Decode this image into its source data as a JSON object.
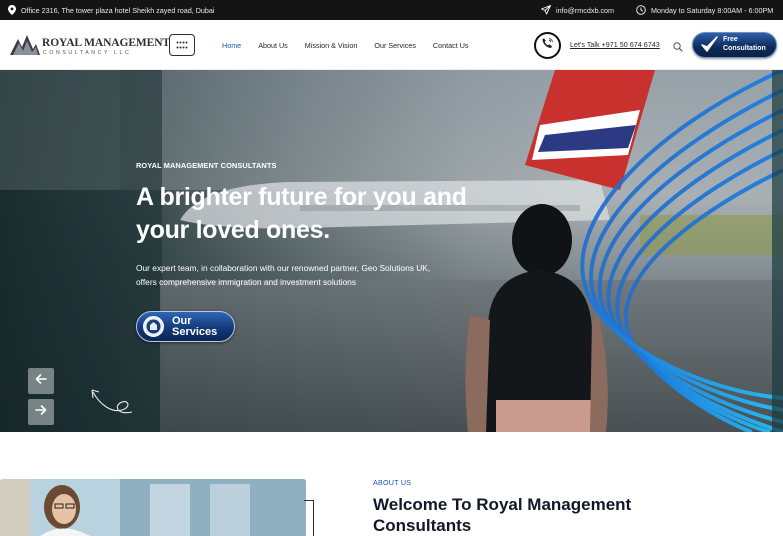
{
  "topbar": {
    "address": "Office 2316, The tower plaza hotel Sheikh zayed road, Dubai",
    "email": "info@rmcdxb.com",
    "hours": "Monday to Saturday 8:00AM - 6:00PM"
  },
  "header": {
    "logo": {
      "name": "ROYAL MANAGEMENT",
      "tagline": "CONSULTANCY LLC"
    },
    "nav": [
      "Home",
      "About Us",
      "Mission & Vision",
      "Our Services",
      "Contact Us"
    ],
    "active_nav": "Home",
    "lets_talk": "Let's Talk +971 50 674 6743",
    "cta": {
      "line1": "Free",
      "line2": "Consultation"
    }
  },
  "hero": {
    "label": "ROYAL MANAGEMENT CONSULTANTS",
    "title": "A brighter future for you and your loved ones.",
    "description": "Our expert team, in collaboration with our renowned partner, Geo Solutions UK, offers comprehensive immigration and investment solutions",
    "button": {
      "line1": "Our",
      "line2": "Services"
    }
  },
  "about": {
    "label": "ABOUT US",
    "title": "Welcome To Royal Management Consultants"
  },
  "colors": {
    "topbar_bg": "#141414",
    "accent_blue": "#1b56b6",
    "cta_navy": "#0e2a5b",
    "heading_dark": "#111827"
  },
  "icons": [
    "location-pin-icon",
    "send-icon",
    "clock-icon",
    "grid-icon",
    "phone-icon",
    "search-icon",
    "check-icon",
    "arrow-left-icon",
    "arrow-right-icon"
  ]
}
